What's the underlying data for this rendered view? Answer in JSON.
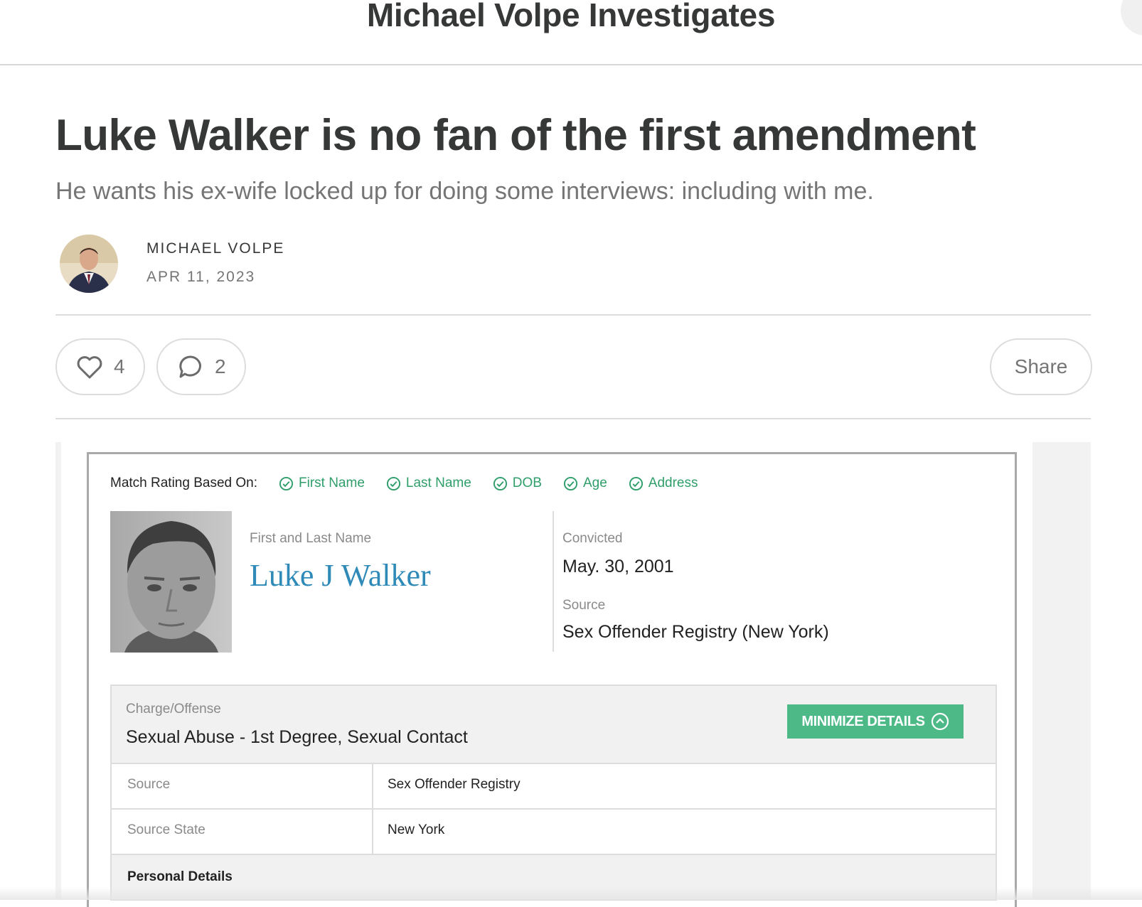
{
  "header": {
    "publication_title": "Michael Volpe Investigates"
  },
  "article": {
    "title": "Luke Walker is no fan of the first amendment",
    "subtitle": "He wants his ex-wife locked up for doing some interviews: including with me.",
    "author": "MICHAEL VOLPE",
    "date": "APR 11, 2023"
  },
  "actions": {
    "like_count": "4",
    "comment_count": "2",
    "share_label": "Share"
  },
  "record": {
    "match_label": "Match Rating Based On:",
    "match_criteria": [
      "First Name",
      "Last Name",
      "DOB",
      "Age",
      "Address"
    ],
    "name_label": "First and Last Name",
    "name": "Luke J Walker",
    "convicted_label": "Convicted",
    "convicted_date": "May. 30, 2001",
    "source_label": "Source",
    "source_value": "Sex Offender Registry (New York)",
    "charge_label": "Charge/Offense",
    "charge_value": "Sexual Abuse - 1st Degree, Sexual Contact",
    "minimize_label": "MINIMIZE DETAILS",
    "details": [
      {
        "key": "Source",
        "value": "Sex Offender Registry"
      },
      {
        "key": "Source State",
        "value": "New York"
      }
    ],
    "section_personal": "Personal Details"
  },
  "colors": {
    "accent_green": "#4cb987",
    "check_green": "#2f9e6a",
    "name_blue": "#2f8ab8"
  },
  "icons": [
    "search-icon",
    "heart-icon",
    "comment-icon",
    "check-circle-icon",
    "chevron-up-circle-icon"
  ]
}
